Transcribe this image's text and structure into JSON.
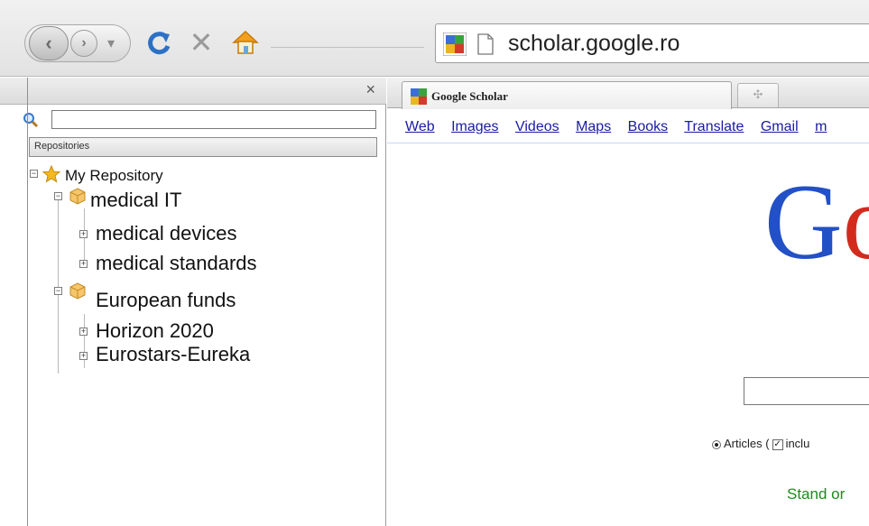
{
  "toolbar": {
    "back_glyph": "‹",
    "forward_glyph": "›",
    "dropdown_glyph": "▾",
    "reload_glyph": "C",
    "stop_glyph": "✕",
    "icons": [
      "back-icon",
      "forward-icon",
      "history-dropdown-icon",
      "reload-icon",
      "stop-icon",
      "home-icon"
    ],
    "url": "scholar.google.ro"
  },
  "sidebar": {
    "close_glyph": "×",
    "search_value": "",
    "header_label": "Repositories",
    "tree": {
      "root": {
        "label": "My Repository",
        "icon": "star-icon"
      },
      "groups": [
        {
          "label": "medical IT",
          "icon": "cube-icon",
          "children": [
            "medical devices",
            "medical standards"
          ]
        },
        {
          "label": "European funds",
          "icon": "cube-icon",
          "children": [
            "Horizon 2020",
            "Eurostars-Eureka"
          ]
        }
      ]
    }
  },
  "browser": {
    "tab_title": "Google Scholar",
    "new_tab_glyph": "✣",
    "nav_links": [
      "Web",
      "Images",
      "Videos",
      "Maps",
      "Books",
      "Translate",
      "Gmail",
      "m"
    ],
    "logo_text": [
      "G",
      "o"
    ],
    "search_value": "",
    "options": {
      "articles_label": "Articles (",
      "include_label": "inclu"
    },
    "tagline": "Stand or"
  },
  "colors": {
    "link": "#1a1aa6",
    "reload": "#2d71c6",
    "logo_blue": "#2250c6",
    "logo_red": "#d22b1e",
    "tagline_green": "#1e8a1e",
    "home_orange": "#f2a01e"
  }
}
